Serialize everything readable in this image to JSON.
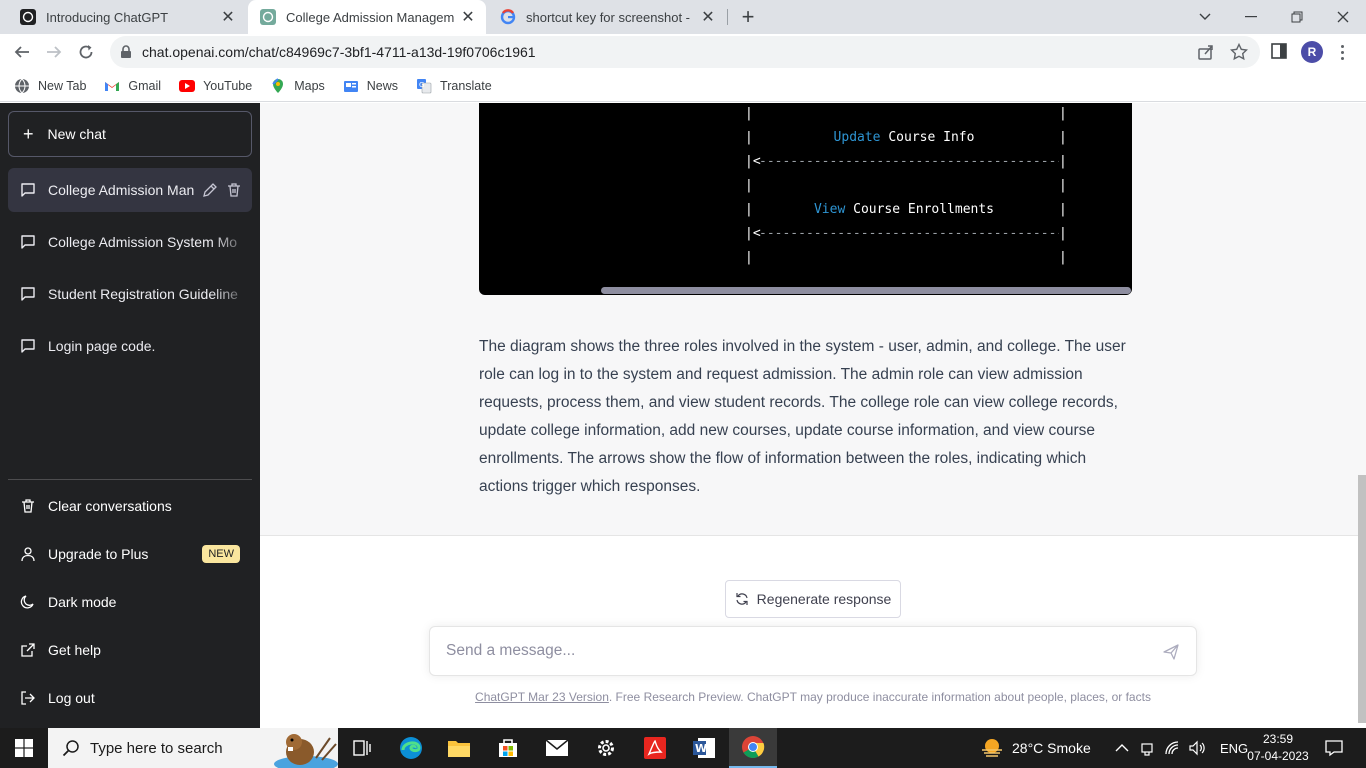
{
  "browser": {
    "tabs": [
      {
        "title": "Introducing ChatGPT",
        "active": false
      },
      {
        "title": "College Admission Management",
        "active": true
      },
      {
        "title": "shortcut key for screenshot - Goo",
        "active": false
      }
    ],
    "url": "chat.openai.com/chat/c84969c7-3bf1-4711-a13d-19f0706c1961",
    "profile_initial": "R",
    "bookmarks": [
      {
        "label": "New Tab",
        "icon": "globe-icon"
      },
      {
        "label": "Gmail",
        "icon": "gmail-icon"
      },
      {
        "label": "YouTube",
        "icon": "youtube-icon"
      },
      {
        "label": "Maps",
        "icon": "maps-icon"
      },
      {
        "label": "News",
        "icon": "news-icon"
      },
      {
        "label": "Translate",
        "icon": "translate-icon"
      }
    ]
  },
  "sidebar": {
    "new_chat": "New chat",
    "conversations": [
      {
        "label": "College Admission Management",
        "active": true
      },
      {
        "label": "College Admission System Mo",
        "active": false
      },
      {
        "label": "Student Registration Guideline",
        "active": false
      },
      {
        "label": "Login page code.",
        "active": false
      }
    ],
    "bottom_items": [
      {
        "label": "Clear conversations",
        "icon": "trash-icon"
      },
      {
        "label": "Upgrade to Plus",
        "icon": "user-icon",
        "badge": "NEW"
      },
      {
        "label": "Dark mode",
        "icon": "moon-icon"
      },
      {
        "label": "Get help",
        "icon": "external-link-icon"
      },
      {
        "label": "Log out",
        "icon": "logout-icon"
      }
    ]
  },
  "main": {
    "code_lines": [
      {
        "left": "|",
        "kw": "",
        "text": "",
        "right": "|"
      },
      {
        "left": "|",
        "kw": "Update",
        "text": " Course Info",
        "right": "|"
      },
      {
        "left": "|<",
        "kw": "",
        "text": "---------------------------------------",
        "right": "|"
      },
      {
        "left": "|",
        "kw": "",
        "text": "",
        "right": "|"
      },
      {
        "left": "|",
        "kw": "View",
        "text": " Course Enrollments",
        "right": "|"
      },
      {
        "left": "|<",
        "kw": "",
        "text": "---------------------------------------",
        "right": "|"
      },
      {
        "left": "|",
        "kw": "",
        "text": "",
        "right": "|"
      }
    ],
    "paragraph": "The diagram shows the three roles involved in the system - user, admin, and college. The user role can log in to the system and request admission. The admin role can view admission requests, process them, and view student records. The college role can view college records, update college information, add new courses, update course information, and view course enrollments. The arrows show the flow of information between the roles, indicating which actions trigger which responses.",
    "regenerate": "Regenerate response",
    "input_placeholder": "Send a message...",
    "footer_link": "ChatGPT Mar 23 Version",
    "footer_text": ". Free Research Preview. ChatGPT may produce inaccurate information about people, places, or facts"
  },
  "taskbar": {
    "search_placeholder": "Type here to search",
    "weather": "28°C  Smoke",
    "language": "ENG",
    "time": "23:59",
    "date": "07-04-2023"
  },
  "colors": {
    "sidebar_bg": "#202123",
    "main_bg": "#f7f7f8",
    "code_keyword": "#2e95d3",
    "badge_bg": "#fae69e"
  }
}
